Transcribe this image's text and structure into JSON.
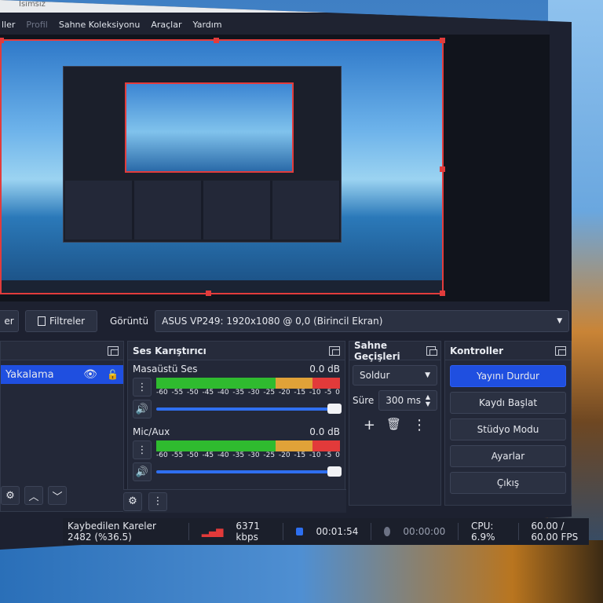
{
  "window": {
    "title": "İsimsiz"
  },
  "menu": [
    "ller",
    "Profil",
    "Sahne Koleksiyonu",
    "Araçlar",
    "Yardım"
  ],
  "toolbar": {
    "partial_label": "er",
    "filters_label": "Filtreler",
    "display_label": "Görüntü",
    "display_value": "ASUS VP249: 1920x1080 @ 0,0 (Birincil Ekran)"
  },
  "sources": {
    "item": "Yakalama"
  },
  "mixer": {
    "title": "Ses Karıştırıcı",
    "channels": [
      {
        "name": "Masaüstü Ses",
        "level": "0.0 dB"
      },
      {
        "name": "Mic/Aux",
        "level": "0.0 dB"
      }
    ],
    "ticks": [
      "-60",
      "-55",
      "-50",
      "-45",
      "-40",
      "-35",
      "-30",
      "-25",
      "-20",
      "-15",
      "-10",
      "-5",
      "0"
    ]
  },
  "transitions": {
    "title": "Sahne Geçişleri",
    "selected": "Soldur",
    "duration_label": "Süre",
    "duration_value": "300 ms"
  },
  "controls": {
    "title": "Kontroller",
    "buttons": [
      "Yayını Durdur",
      "Kaydı Başlat",
      "Stüdyo Modu",
      "Ayarlar",
      "Çıkış"
    ]
  },
  "status": {
    "dropped": "Kaybedilen Kareler 2482 (%36.5)",
    "bitrate": "6371 kbps",
    "stream_time": "00:01:54",
    "record_time": "00:00:00",
    "cpu": "CPU: 6.9%",
    "fps": "60.00 / 60.00 FPS"
  },
  "colors": {
    "accent": "#1f4fe0",
    "panel": "#232838",
    "selection": "#1f4fe0",
    "preview_border": "#e23c3c"
  }
}
